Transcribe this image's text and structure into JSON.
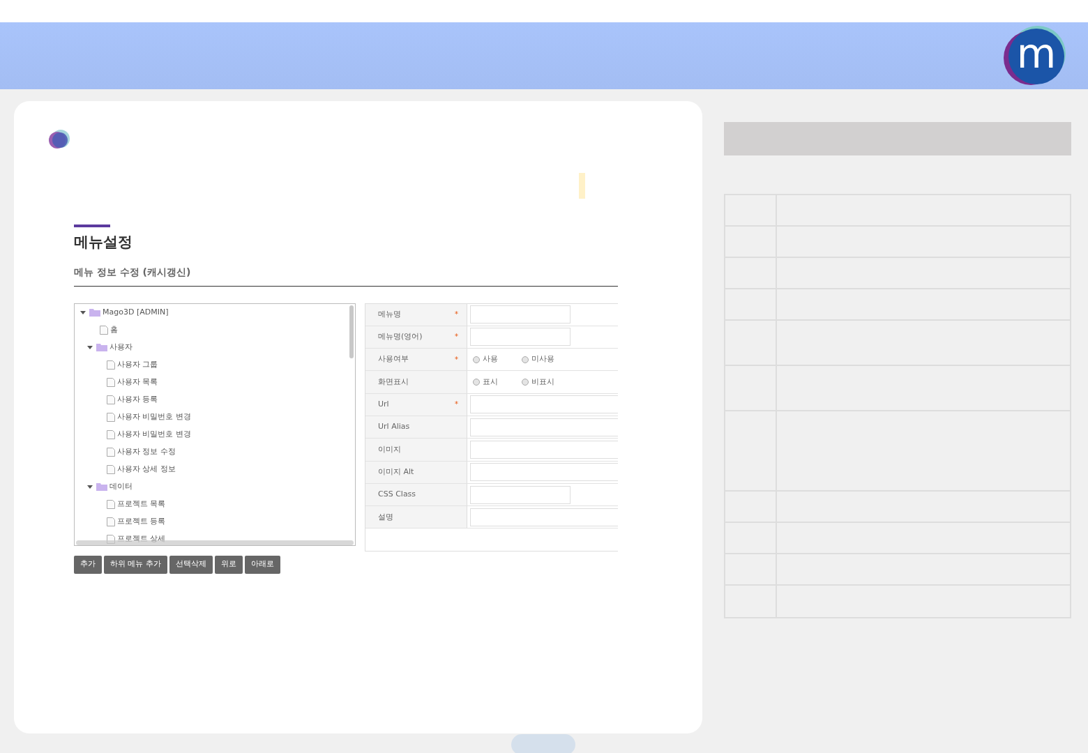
{
  "header": {
    "logo_letter": "m"
  },
  "page": {
    "title": "메뉴설정",
    "subtitle": "메뉴 정보 수정 (캐시갱신)"
  },
  "tree": [
    {
      "kind": "folder",
      "label": "Mago3D [ADMIN]",
      "expanded": true,
      "children": [
        {
          "kind": "page",
          "label": "홈"
        },
        {
          "kind": "folder",
          "label": "사용자",
          "expanded": true,
          "children": [
            {
              "kind": "page",
              "label": "사용자 그룹"
            },
            {
              "kind": "page",
              "label": "사용자 목록"
            },
            {
              "kind": "page",
              "label": "사용자 등록"
            },
            {
              "kind": "page",
              "label": "사용자 비밀번호 변경"
            },
            {
              "kind": "page",
              "label": "사용자 비밀번호 변경"
            },
            {
              "kind": "page",
              "label": "사용자 정보 수정"
            },
            {
              "kind": "page",
              "label": "사용자 상세 정보"
            }
          ]
        },
        {
          "kind": "folder",
          "label": "데이터",
          "expanded": true,
          "children": [
            {
              "kind": "page",
              "label": "프로젝트 목록"
            },
            {
              "kind": "page",
              "label": "프로젝트 등록"
            },
            {
              "kind": "page",
              "label": "프로젝트 상세"
            }
          ]
        }
      ]
    }
  ],
  "buttons": [
    "추가",
    "하위 메뉴 추가",
    "선택삭제",
    "위로",
    "아래로"
  ],
  "form": [
    {
      "label": "메뉴명",
      "required_mark": "*",
      "kind": "short"
    },
    {
      "label": "메뉴명(영어)",
      "required_mark": "*",
      "kind": "short"
    },
    {
      "label": "사용여부",
      "required_mark": "*",
      "kind": "radio",
      "options": [
        {
          "label": "사용",
          "selected": false
        },
        {
          "label": "미사용",
          "selected": false
        }
      ]
    },
    {
      "label": "화면표시",
      "kind": "radio",
      "options": [
        {
          "label": "표시",
          "selected": false
        },
        {
          "label": "비표시",
          "selected": false
        }
      ]
    },
    {
      "label": "Url",
      "required_mark": "*",
      "kind": "long"
    },
    {
      "label": "Url Alias",
      "kind": "long"
    },
    {
      "label": "이미지",
      "kind": "long"
    },
    {
      "label": "이미지 Alt",
      "kind": "long"
    },
    {
      "label": "CSS Class",
      "kind": "short"
    },
    {
      "label": "설명",
      "kind": "long"
    }
  ]
}
